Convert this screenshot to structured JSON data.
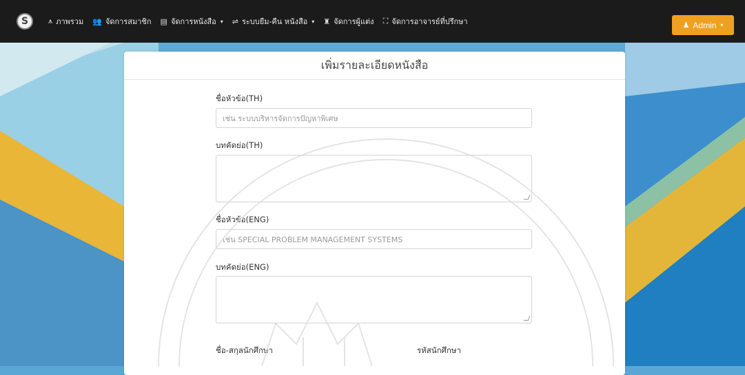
{
  "navbar": {
    "logo_letter": "S",
    "items": [
      {
        "icon": "chart-line-icon",
        "glyph": "⩚",
        "label": "ภาพรวม",
        "caret": ""
      },
      {
        "icon": "users-icon",
        "glyph": "👥",
        "label": "จัดการสมาชิก",
        "caret": ""
      },
      {
        "icon": "book-icon",
        "glyph": "▤",
        "label": "จัดการหนังสือ",
        "caret": "▾"
      },
      {
        "icon": "exchange-icon",
        "glyph": "⇌",
        "label": "ระบบยืม-คืน หนังสือ",
        "caret": "▾"
      },
      {
        "icon": "user-author-icon",
        "glyph": "♜",
        "label": "จัดการผู้แต่ง",
        "caret": ""
      },
      {
        "icon": "advisor-icon",
        "glyph": "⛶",
        "label": "จัดการอาจารย์ที่ปรึกษา",
        "caret": ""
      }
    ],
    "admin_label": "Admin",
    "admin_caret": "▾",
    "admin_icon": "user-icon"
  },
  "form": {
    "title": "เพิ่มรายละเอียดหนังสือ",
    "title_th_label": "ชื่อหัวข้อ(TH)",
    "title_th_placeholder": "เช่น ระบบบริหารจัดการปัญหาพิเศษ",
    "abstract_th_label": "บทคัดย่อ(TH)",
    "title_en_label": "ชื่อหัวข้อ(ENG)",
    "title_en_placeholder": "เช่น SPECIAL PROBLEM MANAGEMENT SYSTEMS",
    "abstract_en_label": "บทคัดย่อ(ENG)",
    "student_name_label": "ชื่อ-สกุลนักศึกษา",
    "student_id_label": "รหัสนักศึกษา"
  },
  "colors": {
    "navbar": "#1b1b1b",
    "admin_button": "#f0a020",
    "background_blue": "#5aa7d6",
    "background_yellow": "#e6b534"
  }
}
